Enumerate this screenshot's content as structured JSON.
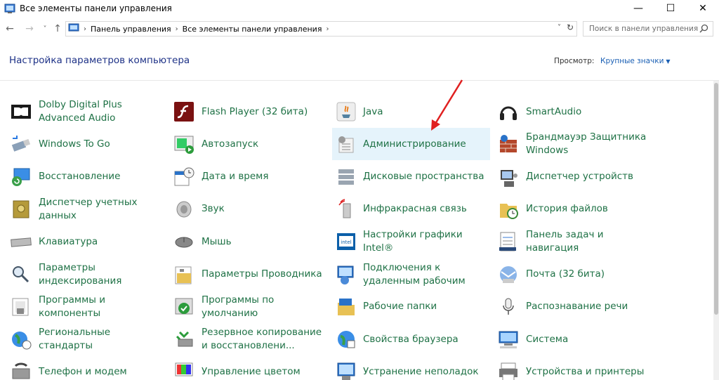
{
  "window": {
    "title": "Все элементы панели управления",
    "minimize": "—",
    "maximize": "☐",
    "close": "✕"
  },
  "nav": {
    "back": "←",
    "forward": "→",
    "recent": "˅",
    "up": "↑"
  },
  "address": {
    "crumbs": [
      "Панель управления",
      "Все элементы панели управления"
    ],
    "separator": "›"
  },
  "search": {
    "placeholder": "Поиск в панели управления"
  },
  "header": {
    "title": "Настройка параметров компьютера",
    "view_label": "Просмотр:",
    "view_value": "Крупные значки"
  },
  "items": [
    {
      "label": "Dolby Digital Plus Advanced Audio",
      "icon": "dolby-icon"
    },
    {
      "label": "Flash Player (32 бита)",
      "icon": "flash-icon"
    },
    {
      "label": "Java",
      "icon": "java-icon"
    },
    {
      "label": "SmartAudio",
      "icon": "headphones-icon"
    },
    {
      "label": "Windows To Go",
      "icon": "usb-drive-icon"
    },
    {
      "label": "Автозапуск",
      "icon": "autoplay-icon"
    },
    {
      "label": "Администрирование",
      "icon": "admin-tools-icon"
    },
    {
      "label": "Брандмауэр Защитника Windows",
      "icon": "firewall-icon"
    },
    {
      "label": "Восстановление",
      "icon": "recovery-icon"
    },
    {
      "label": "Дата и время",
      "icon": "clock-calendar-icon"
    },
    {
      "label": "Дисковые пространства",
      "icon": "storage-spaces-icon"
    },
    {
      "label": "Диспетчер устройств",
      "icon": "device-manager-icon"
    },
    {
      "label": "Диспетчер учетных данных",
      "icon": "credential-vault-icon"
    },
    {
      "label": "Звук",
      "icon": "speaker-icon"
    },
    {
      "label": "Инфракрасная связь",
      "icon": "infrared-icon"
    },
    {
      "label": "История файлов",
      "icon": "file-history-icon"
    },
    {
      "label": "Клавиатура",
      "icon": "keyboard-icon"
    },
    {
      "label": "Мышь",
      "icon": "mouse-icon"
    },
    {
      "label": "Настройки графики Intel®",
      "icon": "intel-graphics-icon"
    },
    {
      "label": "Панель задач и навигация",
      "icon": "taskbar-icon"
    },
    {
      "label": "Параметры индексирования",
      "icon": "indexing-icon"
    },
    {
      "label": "Параметры Проводника",
      "icon": "folder-options-icon"
    },
    {
      "label": "Подключения к удаленным рабочим",
      "icon": "remote-desktop-icon"
    },
    {
      "label": "Почта (32 бита)",
      "icon": "mail-icon"
    },
    {
      "label": "Программы и компоненты",
      "icon": "programs-icon"
    },
    {
      "label": "Программы по умолчанию",
      "icon": "default-programs-icon"
    },
    {
      "label": "Рабочие папки",
      "icon": "work-folders-icon"
    },
    {
      "label": "Распознавание речи",
      "icon": "microphone-icon"
    },
    {
      "label": "Региональные стандарты",
      "icon": "globe-clock-icon"
    },
    {
      "label": "Резервное копирование и восстановлени...",
      "icon": "backup-icon"
    },
    {
      "label": "Свойства браузера",
      "icon": "internet-options-icon"
    },
    {
      "label": "Система",
      "icon": "system-icon"
    },
    {
      "label": "Телефон и модем",
      "icon": "phone-modem-icon"
    },
    {
      "label": "Управление цветом",
      "icon": "color-management-icon"
    },
    {
      "label": "Устранение неполадок",
      "icon": "troubleshooting-icon"
    },
    {
      "label": "Устройства и принтеры",
      "icon": "printer-icon"
    }
  ],
  "colors": {
    "link_green": "#1e7145",
    "title_blue": "#1e3287",
    "hover_bg": "#e5f3fb",
    "arrow_red": "#e02020"
  }
}
